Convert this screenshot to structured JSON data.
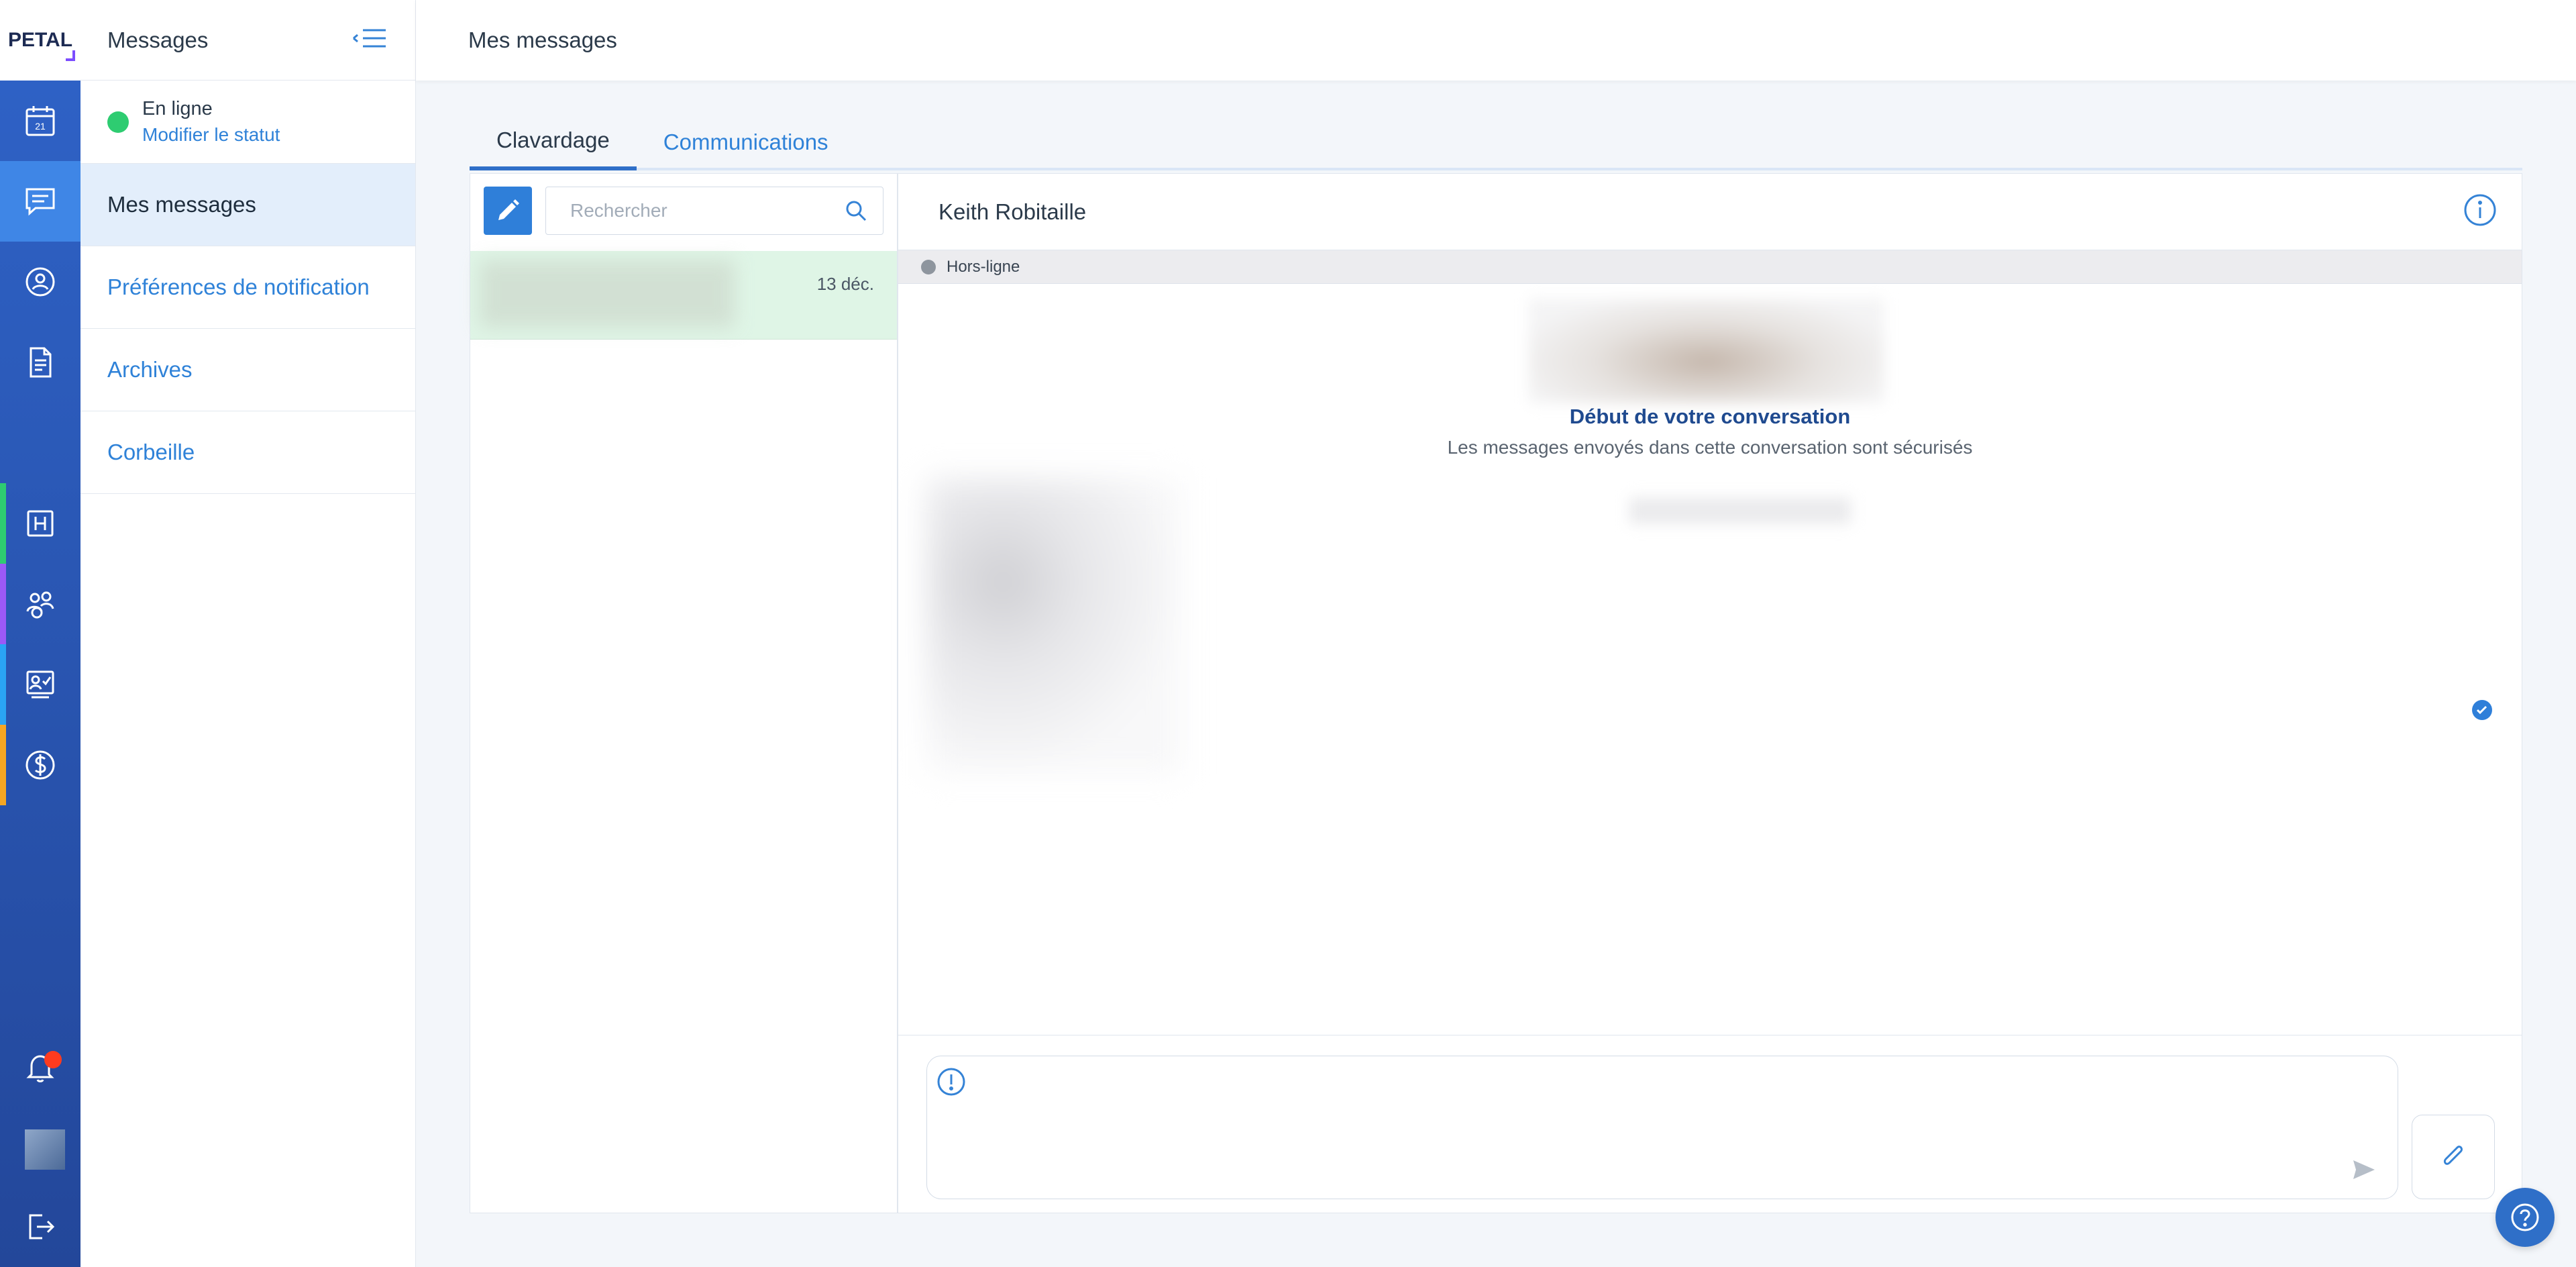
{
  "app": {
    "logo_text": "PETAL"
  },
  "rail": {
    "items": [
      {
        "icon": "calendar-icon",
        "text": "21"
      },
      {
        "icon": "chat-icon",
        "active": true
      },
      {
        "icon": "user-circle-icon"
      },
      {
        "icon": "document-icon"
      },
      {
        "icon": "hospital-icon",
        "accent": "#2ecc71",
        "text": "H"
      },
      {
        "icon": "group-icon",
        "accent": "#9b59f6"
      },
      {
        "icon": "checklist-icon",
        "accent": "#2aa4f4"
      },
      {
        "icon": "dollar-icon",
        "accent": "#f5a623"
      }
    ],
    "bottom": [
      "bell-icon",
      "avatar",
      "logout-icon"
    ]
  },
  "subpanel": {
    "title": "Messages",
    "status": {
      "label": "En ligne",
      "link": "Modifier le statut",
      "color": "#2ecc71"
    },
    "menu": [
      {
        "label": "Mes messages",
        "active": true
      },
      {
        "label": "Préférences de notification"
      },
      {
        "label": "Archives"
      },
      {
        "label": "Corbeille"
      }
    ]
  },
  "topbar": {
    "title": "Mes messages"
  },
  "tabs": [
    {
      "label": "Clavardage",
      "active": true
    },
    {
      "label": "Communications"
    }
  ],
  "conversation_list": {
    "search_placeholder": "Rechercher",
    "items": [
      {
        "date": "13 déc.",
        "selected": true
      }
    ]
  },
  "chat": {
    "contact_name": "Keith Robitaille",
    "presence": "Hors-ligne",
    "start_title": "Début de votre conversation",
    "start_subtitle": "Les messages envoyés dans cette conversation sont sécurisés",
    "composer_placeholder": ""
  },
  "colors": {
    "primary": "#2f7fd9",
    "rail": "#2f63c8",
    "online": "#2ecc71",
    "offline": "#8e959e"
  }
}
